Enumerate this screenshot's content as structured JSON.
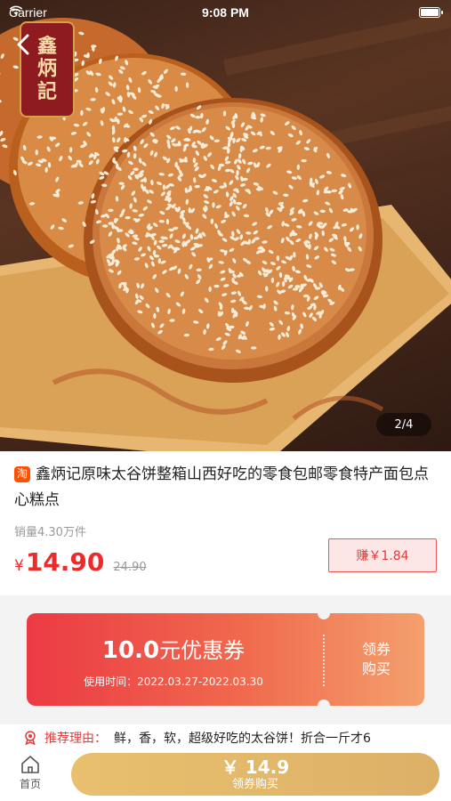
{
  "status_bar": {
    "carrier": "Carrier",
    "time": "9:08 PM"
  },
  "hero": {
    "logo_text": [
      "鑫",
      "炳",
      "記"
    ],
    "page_indicator": "2/4"
  },
  "product": {
    "platform_badge": "淘",
    "title": "鑫炳记原味太谷饼整箱山西好吃的零食包邮零食特产面包点心糕点",
    "sales": "销量4.30万件",
    "price_currency": "¥",
    "price": "14.90",
    "original_price": "24.90",
    "earn_label": "赚￥1.84"
  },
  "coupon": {
    "amount": "10.0",
    "amount_unit": "元优惠券",
    "period": "使用时间：2022.03.27-2022.03.30",
    "action_line1": "领券",
    "action_line2": "购买"
  },
  "recommend": {
    "label": "推荐理由：",
    "text": "鲜，香，软，超级好吃的太谷饼！折合一斤才6"
  },
  "bottom_bar": {
    "home_label": "首页",
    "buy_price": "￥ 14.9",
    "buy_label": "领券购买"
  },
  "colors": {
    "price_red": "#ee2a2a",
    "coupon_start": "#ec3a44",
    "coupon_end": "#f4a06d",
    "buy_button": "#e8c06e",
    "taobao_orange": "#ff5000"
  },
  "icons": [
    "wifi-icon",
    "battery-icon",
    "back-chevron-icon",
    "recommend-badge-icon",
    "home-icon"
  ]
}
